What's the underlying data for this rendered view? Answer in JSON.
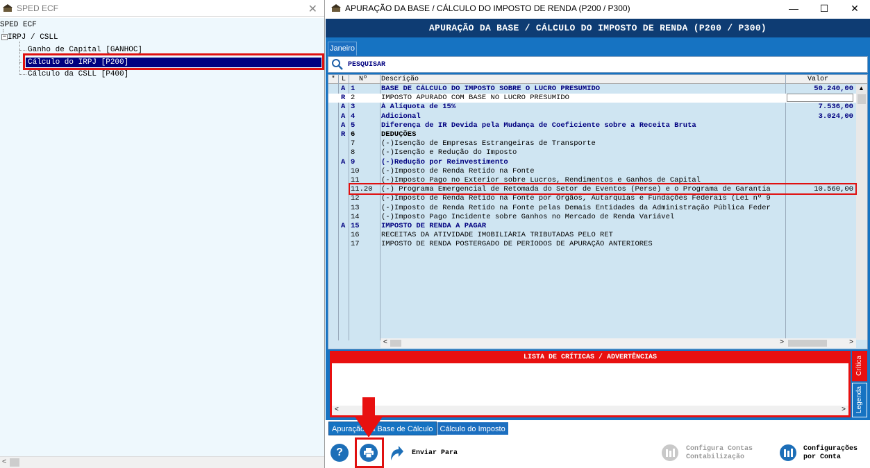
{
  "left_window": {
    "title": "SPED ECF",
    "close": "✕",
    "tree": {
      "root": "SPED ECF",
      "group": "IRPJ / CSLL",
      "items": [
        "Ganho de Capital [GANHOC]",
        "Cálculo do IRPJ [P200]",
        "Cálculo da CSLL [P400]"
      ],
      "selected_index": 1
    },
    "scroll_left": "<"
  },
  "right_window": {
    "title": "APURAÇÃO DA BASE / CÁLCULO DO IMPOSTO DE RENDA (P200 / P300)",
    "buttons": {
      "minimize": "—",
      "maximize": "☐",
      "close": "✕"
    },
    "banner": "APURAÇÃO DA BASE / CÁLCULO DO IMPOSTO DE RENDA (P200 / P300)",
    "tab": "Janeiro",
    "search_label": "PESQUISAR",
    "grid": {
      "headers": {
        "star": "*",
        "l": "L",
        "num": "Nº",
        "desc": "Descrição",
        "value": "Valor"
      },
      "rows": [
        {
          "flag": "A",
          "num": "1",
          "desc": "BASE DE CÁLCULO DO IMPOSTO SOBRE O LUCRO PRESUMIDO",
          "value": "50.240,00",
          "style": "blue"
        },
        {
          "flag": "R",
          "num": "2",
          "desc": "IMPOSTO APURADO COM BASE NO LUCRO PRESUMIDO",
          "value": "",
          "style": "white"
        },
        {
          "flag": "A",
          "num": "3",
          "desc": "À Alíquota de 15%",
          "value": "7.536,00",
          "style": "blue"
        },
        {
          "flag": "A",
          "num": "4",
          "desc": "Adicional",
          "value": "3.024,00",
          "style": "blue"
        },
        {
          "flag": "A",
          "num": "5",
          "desc": "Diferença de IR Devida pela Mudança de Coeficiente sobre a Receita Bruta",
          "value": "",
          "style": "blue"
        },
        {
          "flag": "R",
          "num": "6",
          "desc": "DEDUÇÕES",
          "value": "",
          "style": "bold"
        },
        {
          "flag": "",
          "num": "7",
          "desc": "(-)Isenção de Empresas Estrangeiras de Transporte",
          "value": "",
          "style": "plain"
        },
        {
          "flag": "",
          "num": "8",
          "desc": "(-)Isenção e Redução do Imposto",
          "value": "",
          "style": "plain"
        },
        {
          "flag": "A",
          "num": "9",
          "desc": "(-)Redução por Reinvestimento",
          "value": "",
          "style": "blue"
        },
        {
          "flag": "",
          "num": "10",
          "desc": "(-)Imposto de Renda Retido na Fonte",
          "value": "",
          "style": "plain"
        },
        {
          "flag": "",
          "num": "11",
          "desc": "(-)Imposto Pago no Exterior sobre Lucros, Rendimentos e Ganhos de Capital",
          "value": "",
          "style": "plain"
        },
        {
          "flag": "",
          "num": "11.20",
          "desc": "(-) Programa Emergencial de Retomada do Setor de Eventos (Perse) e o Programa de Garantia",
          "value": "10.560,00",
          "style": "plain"
        },
        {
          "flag": "",
          "num": "12",
          "desc": "(-)Imposto de Renda Retido na Fonte por Orgãos, Autarquias e Fundações Federais (Lei nº 9",
          "value": "",
          "style": "plain"
        },
        {
          "flag": "",
          "num": "13",
          "desc": "(-)Imposto de Renda Retido na Fonte pelas Demais Entidades da Administração Pública Feder",
          "value": "",
          "style": "plain"
        },
        {
          "flag": "",
          "num": "14",
          "desc": "(-)Imposto Pago Incidente sobre Ganhos no Mercado de Renda Variável",
          "value": "",
          "style": "plain"
        },
        {
          "flag": "A",
          "num": "15",
          "desc": "IMPOSTO DE RENDA A PAGAR",
          "value": "",
          "style": "blue"
        },
        {
          "flag": "",
          "num": "16",
          "desc": "RECEITAS DA ATIVIDADE IMOBILIÁRIA TRIBUTADAS PELO RET",
          "value": "",
          "style": "plain"
        },
        {
          "flag": "",
          "num": "17",
          "desc": "IMPOSTO DE RENDA POSTERGADO DE PERÍODOS DE APURAÇÃO ANTERIORES",
          "value": "",
          "style": "plain"
        }
      ],
      "highlighted_row": 11
    },
    "criticas": {
      "title": "LISTA DE CRÍTICAS / ADVERTÊNCIAS",
      "side_tabs": [
        "Crítica",
        "Legenda"
      ]
    },
    "bottom_tabs": [
      "Apuração da Base de Cálculo",
      "Cálculo do Imposto"
    ],
    "toolbar": {
      "help": "?",
      "send_label": "Enviar Para",
      "config_contas": [
        "Configura Contas",
        "Contabilização"
      ],
      "config_conta": [
        "Configurações",
        "por Conta"
      ]
    },
    "colors": {
      "banner": "#0e3c73",
      "accent_red": "#e01010",
      "panel_blue": "#1673c2"
    }
  }
}
